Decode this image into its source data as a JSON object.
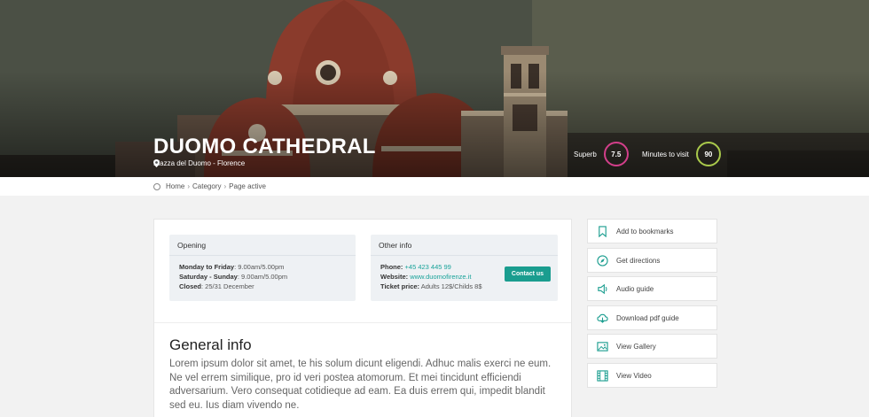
{
  "hero": {
    "title": "DUOMO CATHEDRAL",
    "location": "Piazza del Duomo - Florence",
    "rating_label": "Superb",
    "rating_value": "7.5",
    "visit_label": "Minutes to visit",
    "visit_value": "90"
  },
  "breadcrumb": [
    "Home",
    "Category",
    "Page active"
  ],
  "opening": {
    "title": "Opening",
    "rows": [
      {
        "label": "Monday to Friday",
        "value": ": 9.00am/5.00pm"
      },
      {
        "label": "Saturday - Sunday",
        "value": ": 9.00am/5.00pm"
      },
      {
        "label": "Closed",
        "value": ": 25/31 December"
      }
    ]
  },
  "other": {
    "title": "Other info",
    "phone_label": "Phone:",
    "phone": "+45 423 445 99",
    "website_label": "Website:",
    "website": "www.duomofirenze.it",
    "ticket_label": "Ticket price:",
    "ticket": "Adults 12$/Childs 8$",
    "contact_button": "Contact us"
  },
  "general": {
    "title": "General info",
    "text": "Lorem ipsum dolor sit amet, te his solum dicunt eligendi. Adhuc malis exerci ne eum. Ne vel errem similique, pro id veri postea atomorum. Et mei tincidunt efficiendi adversarium. Vero consequat cotidieque ad eam. Ea duis errem qui, impedit blandit sed eu. Ius diam vivendo ne."
  },
  "sidebar": [
    {
      "label": "Add to bookmarks",
      "icon": "bookmark-icon"
    },
    {
      "label": "Get directions",
      "icon": "compass-icon"
    },
    {
      "label": "Audio guide",
      "icon": "speaker-icon"
    },
    {
      "label": "Download pdf guide",
      "icon": "cloud-download-icon"
    },
    {
      "label": "View Gallery",
      "icon": "image-icon"
    },
    {
      "label": "View Video",
      "icon": "film-icon"
    }
  ],
  "colors": {
    "accent": "#1a9d8f",
    "rating_ring": "#d23f8a",
    "visit_ring": "#a9c94b"
  }
}
